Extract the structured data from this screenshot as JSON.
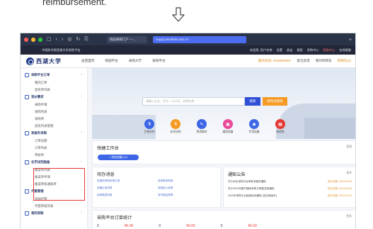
{
  "document": {
    "text": "reimbursement."
  },
  "browser": {
    "inactive_tab": "校园采购门户 — ...",
    "active_tab": "supply.westlake.edu.cn",
    "colors": {
      "close": "#ff5f57",
      "minimize": "#febc2e",
      "maximize": "#28c840",
      "active_tab": "#4b6df2"
    }
  },
  "system_bar": {
    "left": "中国科学院西湖大学采购平台",
    "items": [
      "欢迎您, 用户名称",
      "设置",
      "退出",
      "报表",
      "采购中心",
      "帮助中心",
      "在线客服"
    ]
  },
  "header": {
    "logo_text": "西湖大学",
    "nav": [
      "返回首页",
      "校园平台",
      "采购大厅",
      "采购平台",
      "服务中心"
    ],
    "phone": "服务热线: 4006968382",
    "links": [
      "意见反馈",
      "我的购物车"
    ],
    "cart": "购物车(0)"
  },
  "sidebar": {
    "groups": [
      {
        "label": "采购平台订单",
        "items": [
          "我的订单",
          "退货单列表"
        ]
      },
      {
        "label": "竞价需求",
        "items": [
          "采购申请",
          "采购列表",
          "采购单",
          "退货列表管理"
        ]
      },
      {
        "label": "系统外采购",
        "items": [
          "订单创建",
          "订单列表",
          "审核单"
        ]
      },
      {
        "label": "化学试剂报备",
        "items": [
          "备案单列表",
          "备案单申请",
          "备案审核通知单"
        ]
      },
      {
        "label": "代管管理",
        "items": [
          "添加代管",
          "代管审核列表"
        ]
      },
      {
        "label": "我的采购",
        "items": []
      }
    ]
  },
  "banner": {
    "search_placeholder": "请输入品名、货号、CAS号、品牌名称",
    "search_button": "搜索",
    "structure_button": "结构式搜索",
    "categories": [
      "生物试剂",
      "化学试剂",
      "常用耗材",
      "通用设备",
      "专用设备",
      "其他类"
    ]
  },
  "quick": {
    "title": "快捷工作台",
    "more": "管理",
    "button": "+ 添加快捷入口"
  },
  "todo": {
    "title": "待办消息",
    "items": [
      "待退货采购申请订单",
      "待审核采购单",
      "待确认收货单",
      "待验收入库单",
      "待审核退货单",
      "待付款结算单"
    ]
  },
  "notice": {
    "title": "通知公告",
    "more": "更多",
    "items": [
      {
        "text": "关于优化采购平台审批流程的通知",
        "date": "发布日期: 2022/03/18"
      },
      {
        "text": "关于2022年春节期间采购订单配送的通知",
        "date": "发布日期: 2022/01/26"
      },
      {
        "text": "2022年采购平台使用培训通知 (供应商版本)",
        "date": "发布日期: 2022/01/10"
      }
    ]
  },
  "stats": {
    "title": "采购平台订单统计",
    "more": "更多",
    "values": [
      "0",
      "¥0.00",
      "0",
      "¥0.00",
      "0",
      "¥0.00"
    ]
  }
}
